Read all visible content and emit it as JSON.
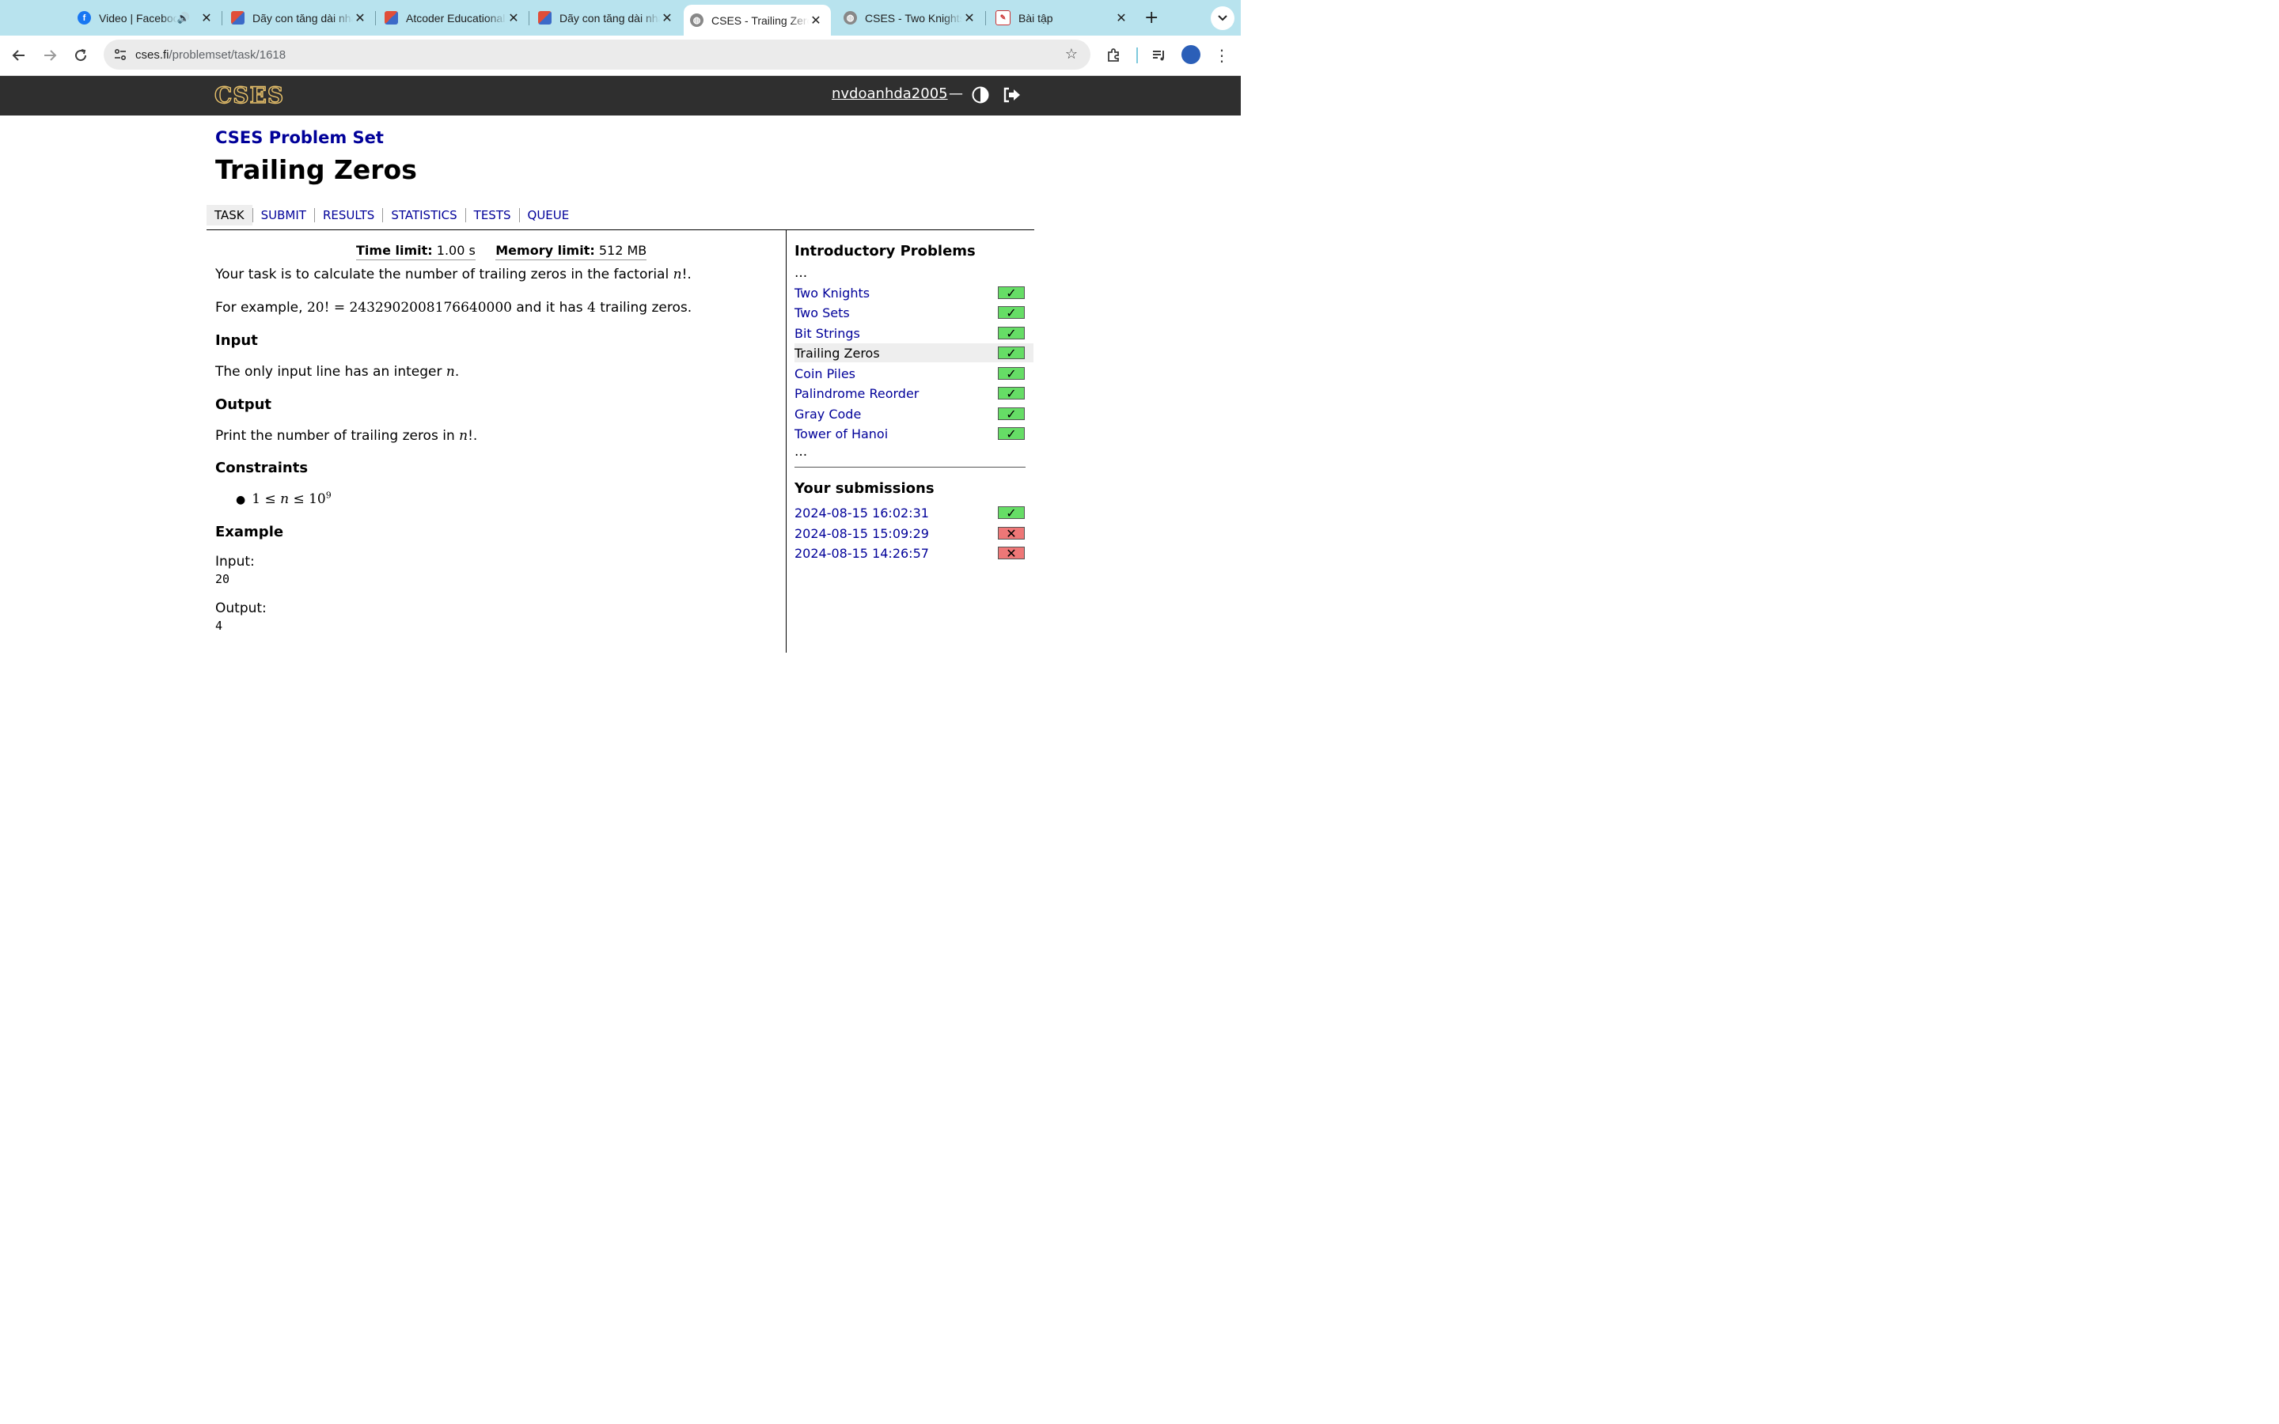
{
  "browser": {
    "tabs": [
      {
        "title": "Video | Facebook",
        "favicon": "facebook-icon"
      },
      {
        "title": "Dãy con tăng dài nhất",
        "favicon": "vnoi-icon"
      },
      {
        "title": "Atcoder Educational DP",
        "favicon": "vnoi-icon"
      },
      {
        "title": "Dãy con tăng dài nhất",
        "favicon": "vnoi-icon"
      },
      {
        "title": "CSES - Trailing Zeros",
        "favicon": "globe-icon"
      },
      {
        "title": "CSES - Two Knights",
        "favicon": "globe-icon"
      },
      {
        "title": "Bài tập",
        "favicon": "doc-icon"
      }
    ],
    "url_host": "cses.fi",
    "url_path": "/problemset/task/1618"
  },
  "site": {
    "logo": "CSES",
    "username": "nvdoanhda2005",
    "dash": "—"
  },
  "page": {
    "section_link": "CSES Problem Set",
    "title": "Trailing Zeros",
    "nav": [
      "TASK",
      "SUBMIT",
      "RESULTS",
      "STATISTICS",
      "TESTS",
      "QUEUE"
    ]
  },
  "task": {
    "time_limit_label": "Time limit:",
    "time_limit_value": "1.00 s",
    "memory_limit_label": "Memory limit:",
    "memory_limit_value": "512 MB",
    "p1_a": "Your task is to calculate the number of trailing zeros in the factorial ",
    "p1_math": "n",
    "p1_b": "!.",
    "p2_a": "For example, ",
    "p2_math": "20! = 2432902008176640000",
    "p2_b": " and it has ",
    "p2_math2": "4",
    "p2_c": " trailing zeros.",
    "input_heading": "Input",
    "input_a": "The only input line has an integer ",
    "input_math": "n",
    "input_b": ".",
    "output_heading": "Output",
    "output_a": "Print the number of trailing zeros in ",
    "output_math": "n",
    "output_b": "!.",
    "constraints_heading": "Constraints",
    "constraint_a": "1 ≤ ",
    "constraint_n": "n",
    "constraint_b": " ≤ 10",
    "constraint_exp": "9",
    "example_heading": "Example",
    "ex_input_label": "Input:",
    "ex_input_value": "20",
    "ex_output_label": "Output:",
    "ex_output_value": "4"
  },
  "sidebar": {
    "section_title": "Introductory Problems",
    "ellipsis": "...",
    "problems": [
      {
        "name": "Two Knights",
        "status": "accepted"
      },
      {
        "name": "Two Sets",
        "status": "accepted"
      },
      {
        "name": "Bit Strings",
        "status": "accepted"
      },
      {
        "name": "Trailing Zeros",
        "status": "accepted"
      },
      {
        "name": "Coin Piles",
        "status": "accepted"
      },
      {
        "name": "Palindrome Reorder",
        "status": "accepted"
      },
      {
        "name": "Gray Code",
        "status": "accepted"
      },
      {
        "name": "Tower of Hanoi",
        "status": "accepted"
      }
    ],
    "submissions_title": "Your submissions",
    "submissions": [
      {
        "time": "2024-08-15 16:02:31",
        "status": "accepted"
      },
      {
        "time": "2024-08-15 15:09:29",
        "status": "failed"
      },
      {
        "time": "2024-08-15 14:26:57",
        "status": "failed"
      }
    ]
  },
  "colors": {
    "link": "#000099",
    "header_bg": "#2f2f2f",
    "accepted": "#66dd66",
    "failed": "#ee7777",
    "tabstrip": "#b8e3ee"
  }
}
